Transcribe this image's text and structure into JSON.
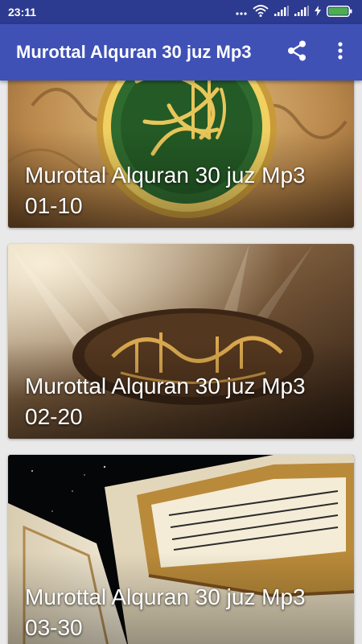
{
  "status_bar": {
    "time": "23:11"
  },
  "app_bar": {
    "title": "Murottal Alquran 30 juz Mp3",
    "actions": [
      {
        "icon": "share-icon"
      },
      {
        "icon": "more-vert-icon"
      }
    ]
  },
  "cards": [
    {
      "title": "Murottal Alquran 30 juz Mp3 01-10"
    },
    {
      "title": "Murottal Alquran 30 juz Mp3 02-20"
    },
    {
      "title": "Murottal Alquran 30 juz Mp3 03-30"
    }
  ],
  "colors": {
    "status_bar": "#2c3a8f",
    "app_bar": "#3f51b5",
    "background": "#e9e9e9",
    "battery": "#4caf50"
  }
}
